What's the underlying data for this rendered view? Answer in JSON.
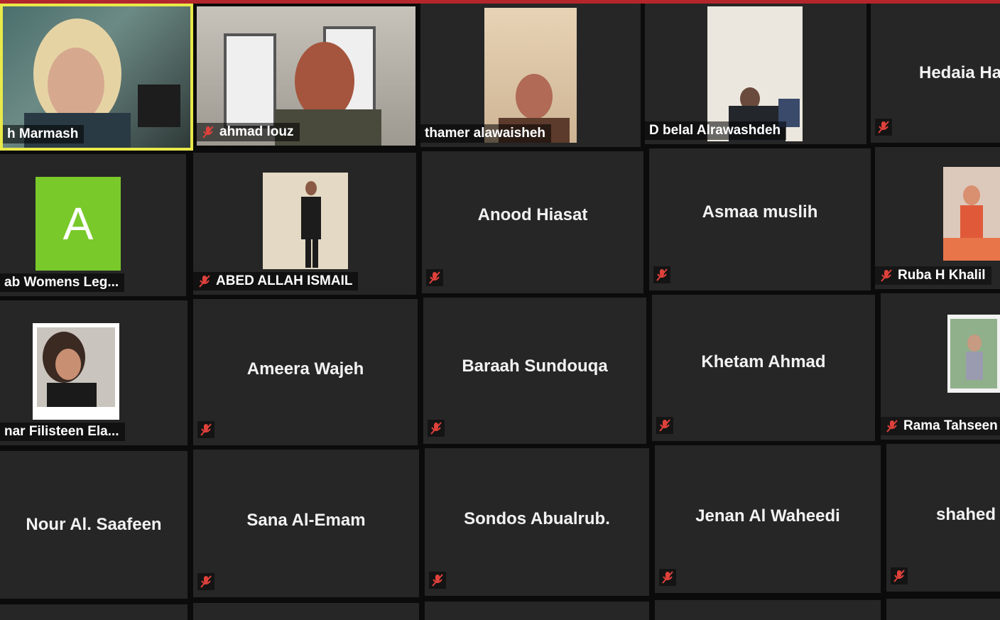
{
  "meeting": {
    "participants": [
      {
        "name": "h Marmash",
        "speaking": true
      },
      {
        "name": "ahmad louz"
      },
      {
        "name": "thamer alawaisheh"
      },
      {
        "name": "D belal Alrawashdeh"
      },
      {
        "name": "Hedaia Ha"
      },
      {
        "name": "ab Womens Leg...",
        "avatar_letter": "A"
      },
      {
        "name": "ABED ALLAH ISMAIL"
      },
      {
        "name": "Anood Hiasat"
      },
      {
        "name": "Asmaa muslih"
      },
      {
        "name": "Ruba H Khalil"
      },
      {
        "name": "nar Filisteen Ela..."
      },
      {
        "name": "Ameera Wajeh"
      },
      {
        "name": "Baraah Sundouqa"
      },
      {
        "name": "Khetam Ahmad"
      },
      {
        "name": "Rama Tahseen"
      },
      {
        "name": "Nour Al. Saafeen"
      },
      {
        "name": "Sana Al-Emam"
      },
      {
        "name": "Sondos Abualrub."
      },
      {
        "name": "Jenan Al Waheedi"
      },
      {
        "name": "shahed"
      }
    ]
  },
  "icons": {
    "muted_mic": "mic-muted-icon"
  },
  "colors": {
    "speaking_border": "#e9e94a",
    "muted_icon": "#e0413b",
    "tile_bg": "#262626",
    "avatar_green": "#7ac92b",
    "top_strip": "#b3262b"
  }
}
